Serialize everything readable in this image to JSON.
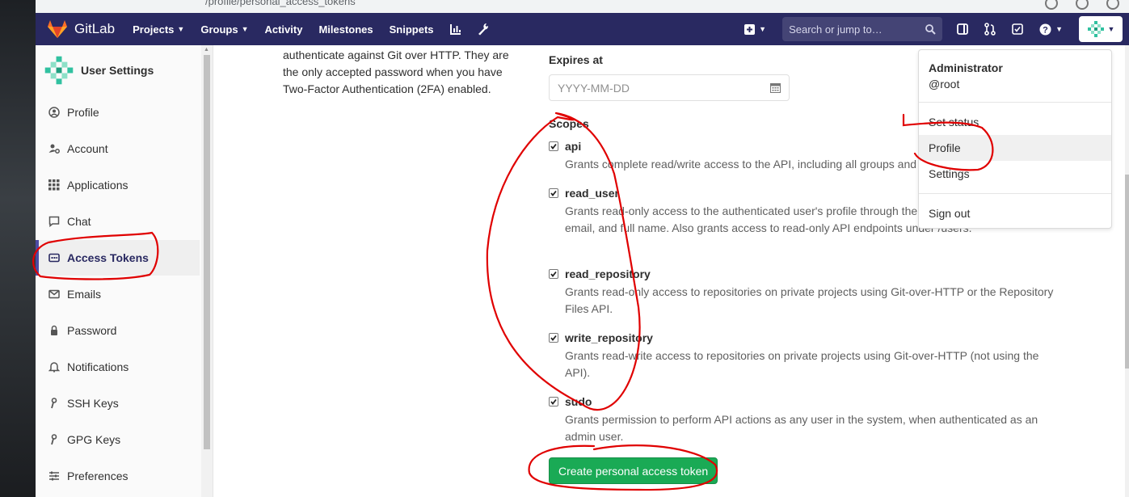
{
  "browser": {
    "url_fragment": "/profile/personal_access_tokens"
  },
  "navbar": {
    "brand": "GitLab",
    "items": [
      {
        "label": "Projects",
        "caret": true
      },
      {
        "label": "Groups",
        "caret": true
      },
      {
        "label": "Activity",
        "caret": false
      },
      {
        "label": "Milestones",
        "caret": false
      },
      {
        "label": "Snippets",
        "caret": false
      }
    ],
    "search_placeholder": "Search or jump to…",
    "colors": {
      "bg": "#292961",
      "search_bg": "#444475"
    }
  },
  "sidebar": {
    "title": "User Settings",
    "items": [
      {
        "label": "Profile",
        "icon": "user-circle-icon",
        "active": false
      },
      {
        "label": "Account",
        "icon": "account-gear-icon",
        "active": false
      },
      {
        "label": "Applications",
        "icon": "applications-grid-icon",
        "active": false
      },
      {
        "label": "Chat",
        "icon": "chat-bubble-icon",
        "active": false
      },
      {
        "label": "Access Tokens",
        "icon": "token-card-icon",
        "active": true
      },
      {
        "label": "Emails",
        "icon": "envelope-icon",
        "active": false
      },
      {
        "label": "Password",
        "icon": "lock-icon",
        "active": false
      },
      {
        "label": "Notifications",
        "icon": "bell-icon",
        "active": false
      },
      {
        "label": "SSH Keys",
        "icon": "key-icon",
        "active": false
      },
      {
        "label": "GPG Keys",
        "icon": "key-icon",
        "active": false
      },
      {
        "label": "Preferences",
        "icon": "sliders-icon",
        "active": false
      }
    ]
  },
  "main": {
    "description": "authenticate against Git over HTTP. They are the only accepted password when you have Two-Factor Authentication (2FA) enabled.",
    "expires_label": "Expires at",
    "date_placeholder": "YYYY-MM-DD",
    "scopes_label": "Scopes",
    "scopes": [
      {
        "name": "api",
        "checked": true,
        "help": "Grants complete read/write access to the API, including all groups and"
      },
      {
        "name": "read_user",
        "checked": true,
        "help": "Grants read-only access to the authenticated user's profile through the includes username, public email, and full name. Also grants access to read-only API endpoints under /users."
      },
      {
        "name": "read_repository",
        "checked": true,
        "help": "Grants read-only access to repositories on private projects using Git-over-HTTP or the Repository Files API."
      },
      {
        "name": "write_repository",
        "checked": true,
        "help": "Grants read-write access to repositories on private projects using Git-over-HTTP (not using the API)."
      },
      {
        "name": "sudo",
        "checked": true,
        "help": "Grants permission to perform API actions as any user in the system, when authenticated as an admin user."
      }
    ],
    "create_button": "Create personal access token"
  },
  "user_dropdown": {
    "name": "Administrator",
    "handle": "@root",
    "items": [
      "Set status",
      "Profile",
      "Settings"
    ],
    "signout": "Sign out",
    "highlighted": "Profile"
  },
  "annotation_color": "#e00000"
}
